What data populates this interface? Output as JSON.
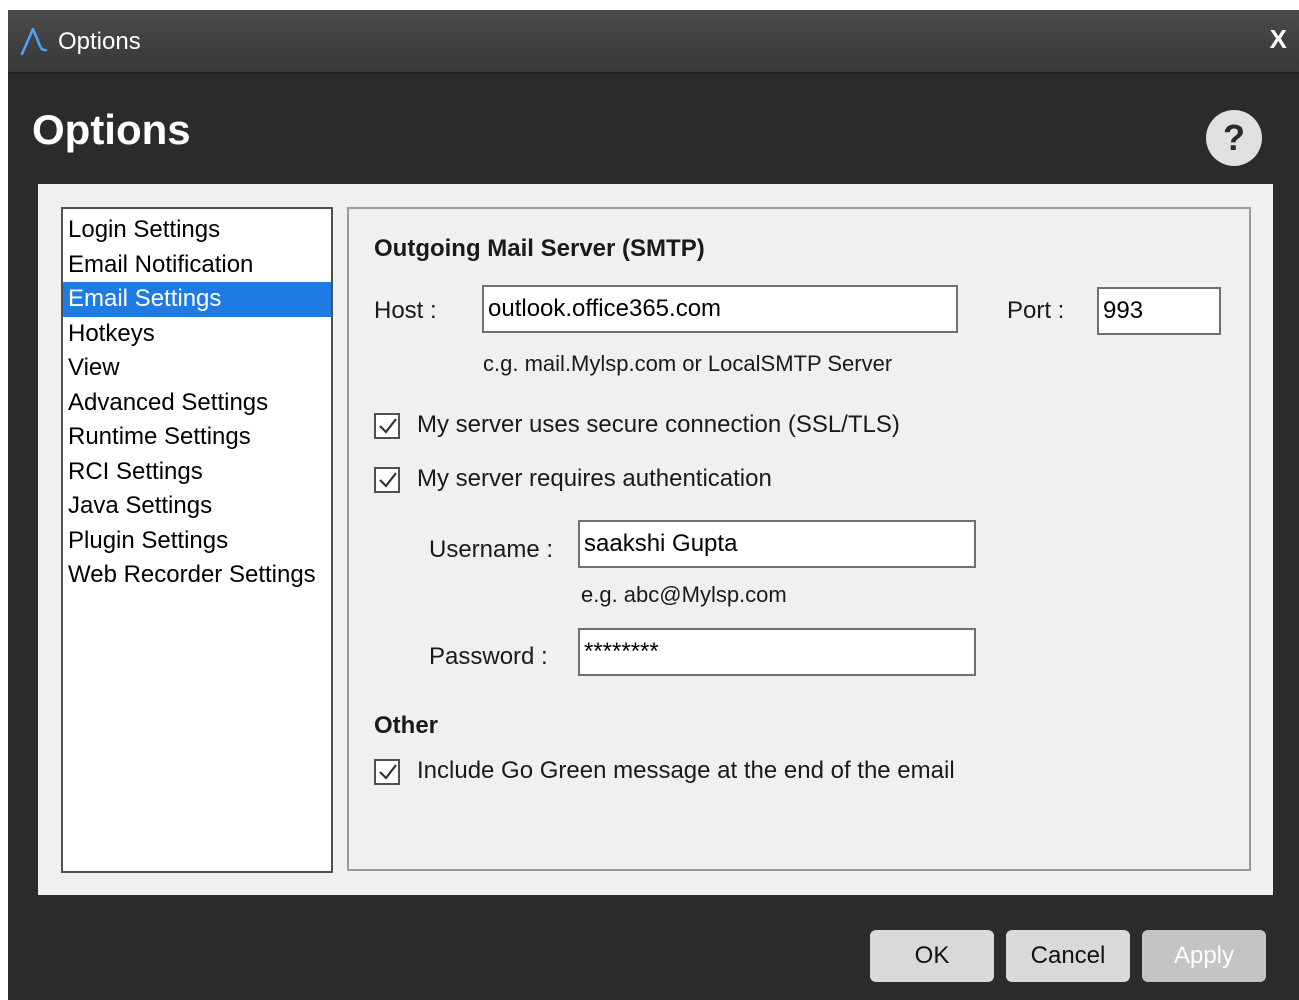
{
  "window": {
    "title": "Options",
    "close_label": "X"
  },
  "page": {
    "title": "Options",
    "help_label": "?"
  },
  "nav": {
    "items": [
      {
        "label": "Login Settings",
        "selected": false
      },
      {
        "label": "Email Notification",
        "selected": false
      },
      {
        "label": "Email Settings",
        "selected": true
      },
      {
        "label": "Hotkeys",
        "selected": false
      },
      {
        "label": "View",
        "selected": false
      },
      {
        "label": "Advanced Settings",
        "selected": false
      },
      {
        "label": "Runtime Settings",
        "selected": false
      },
      {
        "label": "RCI Settings",
        "selected": false
      },
      {
        "label": "Java Settings",
        "selected": false
      },
      {
        "label": "Plugin Settings",
        "selected": false
      },
      {
        "label": "Web Recorder Settings",
        "selected": false
      }
    ]
  },
  "smtp": {
    "section_title": "Outgoing Mail Server (SMTP)",
    "host_label": "Host :",
    "host_value": "outlook.office365.com",
    "host_hint": "c.g. mail.Mylsp.com or LocalSMTP Server",
    "port_label": "Port :",
    "port_value": "993",
    "ssl_label": "My server uses secure connection (SSL/TLS)",
    "ssl_checked": true,
    "auth_label": "My server requires authentication",
    "auth_checked": true,
    "username_label": "Username :",
    "username_value": "saakshi Gupta",
    "username_hint": "e.g. abc@Mylsp.com",
    "password_label": "Password :",
    "password_value": "********"
  },
  "other": {
    "section_title": "Other",
    "go_green_label": "Include Go Green message at the end of the email",
    "go_green_checked": true
  },
  "buttons": {
    "ok": "OK",
    "cancel": "Cancel",
    "apply": "Apply"
  },
  "colors": {
    "selection": "#1e7be4",
    "window_bg": "#2b2b2b",
    "panel_bg": "#f0f0f0"
  },
  "icons": {
    "app": "app-logo-icon",
    "check": "checkmark-icon",
    "help": "question-mark-icon"
  }
}
